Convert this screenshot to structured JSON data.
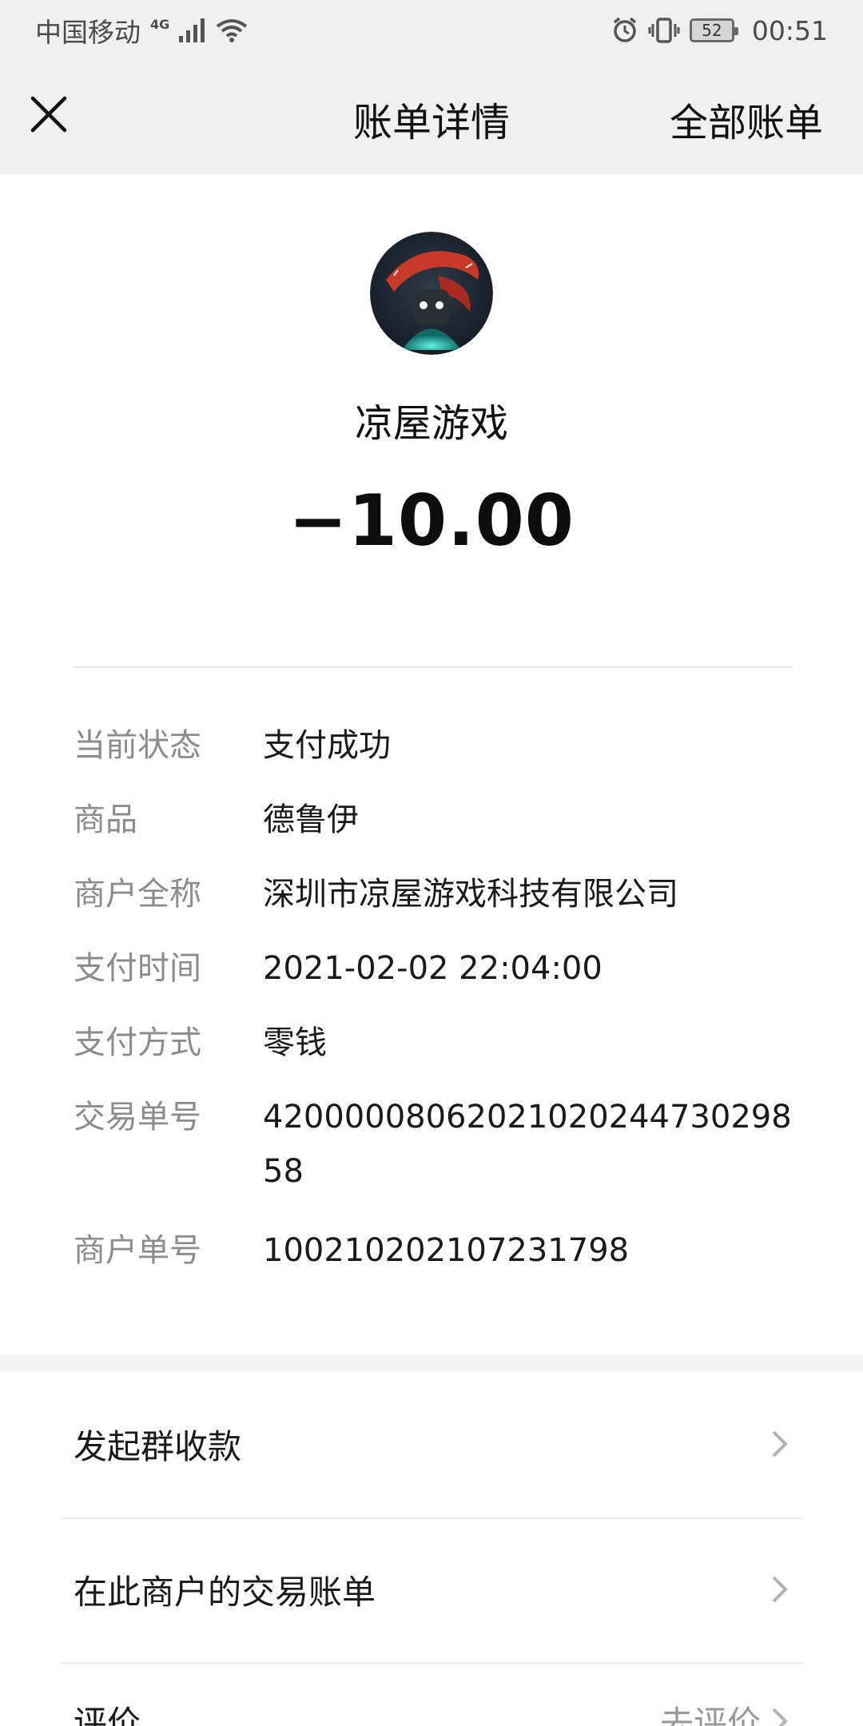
{
  "status_bar": {
    "carrier": "中国移动",
    "network": "4G",
    "battery": "52",
    "time": "00:51"
  },
  "nav": {
    "close_icon": "close-icon",
    "title": "账单详情",
    "all_bills": "全部账单"
  },
  "merchant": {
    "avatar_icon": "game-avatar",
    "name": "凉屋游戏",
    "amount": "−10.00"
  },
  "details": [
    {
      "label": "当前状态",
      "value": "支付成功"
    },
    {
      "label": "商品",
      "value": "德鲁伊"
    },
    {
      "label": "商户全称",
      "value": "深圳市凉屋游戏科技有限公司"
    },
    {
      "label": "支付时间",
      "value": "2021-02-02 22:04:00"
    },
    {
      "label": "支付方式",
      "value": "零钱"
    },
    {
      "label": "交易单号",
      "value": "4200000806202102024473029858"
    },
    {
      "label": "商户单号",
      "value": "100210202107231798"
    }
  ],
  "actions": [
    {
      "label": "发起群收款",
      "extra": ""
    },
    {
      "label": "在此商户的交易账单",
      "extra": ""
    },
    {
      "label": "评价",
      "extra": "去评价"
    }
  ],
  "colors": {
    "header_bg": "#f0f0f0",
    "label_gray": "#8c8c8c",
    "text_dark": "#1a1a1a"
  }
}
